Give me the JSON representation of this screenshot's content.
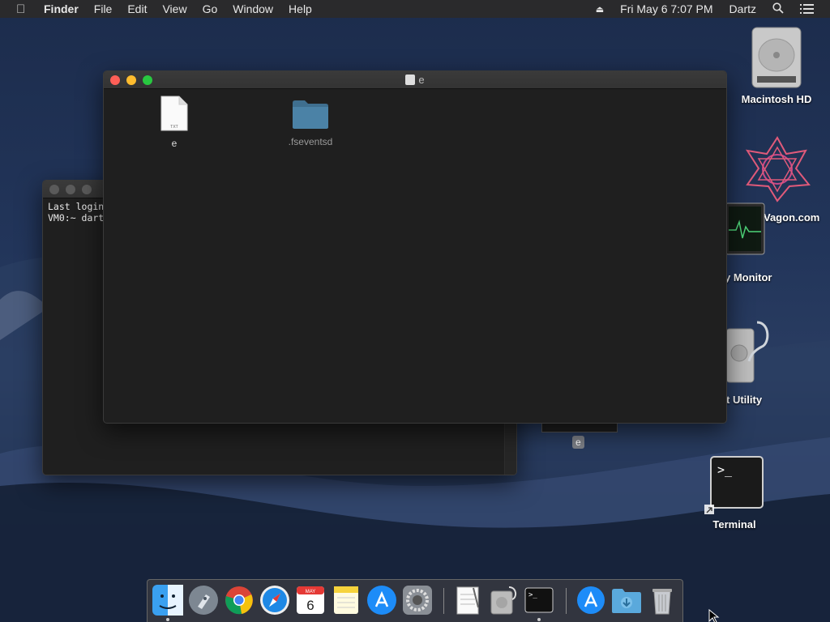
{
  "menubar": {
    "app_name": "Finder",
    "items": [
      "File",
      "Edit",
      "View",
      "Go",
      "Window",
      "Help"
    ],
    "datetime": "Fri May 6  7:07 PM",
    "user": "Dartz"
  },
  "desktop_icons": {
    "macintosh_hd": "Macintosh HD",
    "wagon": "Vagon.com",
    "activity_monitor": "y Monitor",
    "disk_utility": "t Utility",
    "terminal": "Terminal",
    "e_label": "e"
  },
  "terminal_window": {
    "line1": "Last login",
    "line2": "VM0:~ dart"
  },
  "finder_window": {
    "title": "e",
    "files": [
      {
        "name": "e",
        "type_badge": "TXT"
      },
      {
        "name": ".fseventsd"
      }
    ]
  },
  "dock": {
    "items": [
      "finder-icon",
      "launchpad-icon",
      "chrome-icon",
      "safari-icon",
      "calendar-icon",
      "notes-icon",
      "app-store-icon",
      "system-preferences-icon",
      "textedit-icon",
      "disk-utility-icon",
      "terminal-icon",
      "app-store-downloads-icon",
      "downloads-folder-icon",
      "trash-icon"
    ],
    "calendar_month": "MAY",
    "calendar_day": "6"
  },
  "colors": {
    "close": "#fe5f57",
    "minimize": "#febc2e",
    "zoom": "#28c840"
  }
}
